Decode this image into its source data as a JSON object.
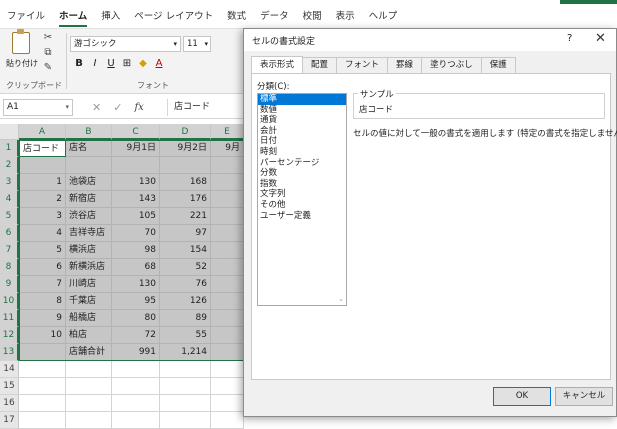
{
  "menu": {
    "tabs": [
      "ファイル",
      "ホーム",
      "挿入",
      "ページ レイアウト",
      "数式",
      "データ",
      "校閲",
      "表示",
      "ヘルプ"
    ],
    "active_tab": "ホーム"
  },
  "ribbon": {
    "paste_label": "貼り付け",
    "clipboard_group": "クリップボード",
    "font_name": "游ゴシック",
    "font_size": "11",
    "font_group": "フォント",
    "bold": "B",
    "italic": "I",
    "underline": "U"
  },
  "formula_bar": {
    "name_box": "A1",
    "fx": "fx",
    "value": "店コード"
  },
  "sheet": {
    "columns": [
      "A",
      "B",
      "C",
      "D",
      "E"
    ],
    "rows": [
      {
        "n": "1",
        "a": "店コード",
        "b": "店名",
        "c": "9月1日",
        "d": "9月2日",
        "e": "9月"
      },
      {
        "n": "2",
        "a": "",
        "b": "",
        "c": "",
        "d": "",
        "e": ""
      },
      {
        "n": "3",
        "a": "1",
        "b": "池袋店",
        "c": "130",
        "d": "168",
        "e": ""
      },
      {
        "n": "4",
        "a": "2",
        "b": "新宿店",
        "c": "143",
        "d": "176",
        "e": ""
      },
      {
        "n": "5",
        "a": "3",
        "b": "渋谷店",
        "c": "105",
        "d": "221",
        "e": ""
      },
      {
        "n": "6",
        "a": "4",
        "b": "吉祥寺店",
        "c": "70",
        "d": "97",
        "e": ""
      },
      {
        "n": "7",
        "a": "5",
        "b": "横浜店",
        "c": "98",
        "d": "154",
        "e": ""
      },
      {
        "n": "8",
        "a": "6",
        "b": "新横浜店",
        "c": "68",
        "d": "52",
        "e": ""
      },
      {
        "n": "9",
        "a": "7",
        "b": "川崎店",
        "c": "130",
        "d": "76",
        "e": ""
      },
      {
        "n": "10",
        "a": "8",
        "b": "千葉店",
        "c": "95",
        "d": "126",
        "e": ""
      },
      {
        "n": "11",
        "a": "9",
        "b": "船橋店",
        "c": "80",
        "d": "89",
        "e": ""
      },
      {
        "n": "12",
        "a": "10",
        "b": "柏店",
        "c": "72",
        "d": "55",
        "e": ""
      },
      {
        "n": "13",
        "a": "",
        "b": "店舗合計",
        "c": "991",
        "d": "1,214",
        "e": ""
      },
      {
        "n": "14",
        "a": "",
        "b": "",
        "c": "",
        "d": "",
        "e": ""
      },
      {
        "n": "15",
        "a": "",
        "b": "",
        "c": "",
        "d": "",
        "e": ""
      },
      {
        "n": "16",
        "a": "",
        "b": "",
        "c": "",
        "d": "",
        "e": ""
      },
      {
        "n": "17",
        "a": "",
        "b": "",
        "c": "",
        "d": "",
        "e": ""
      }
    ]
  },
  "dialog": {
    "title": "セルの書式設定",
    "help": "?",
    "close": "✕",
    "tabs": [
      "表示形式",
      "配置",
      "フォント",
      "罫線",
      "塗りつぶし",
      "保護"
    ],
    "active_tab": "表示形式",
    "category_label": "分類(C):",
    "categories": [
      "標準",
      "数値",
      "通貨",
      "会計",
      "日付",
      "時刻",
      "パーセンテージ",
      "分数",
      "指数",
      "文字列",
      "その他",
      "ユーザー定義"
    ],
    "selected_category": "標準",
    "sample_label": "サンプル",
    "sample_value": "店コード",
    "description": "セルの値に対して一般の書式を適用します (特定の書式を指定しません)。",
    "ok": "OK",
    "cancel": "キャンセル"
  }
}
